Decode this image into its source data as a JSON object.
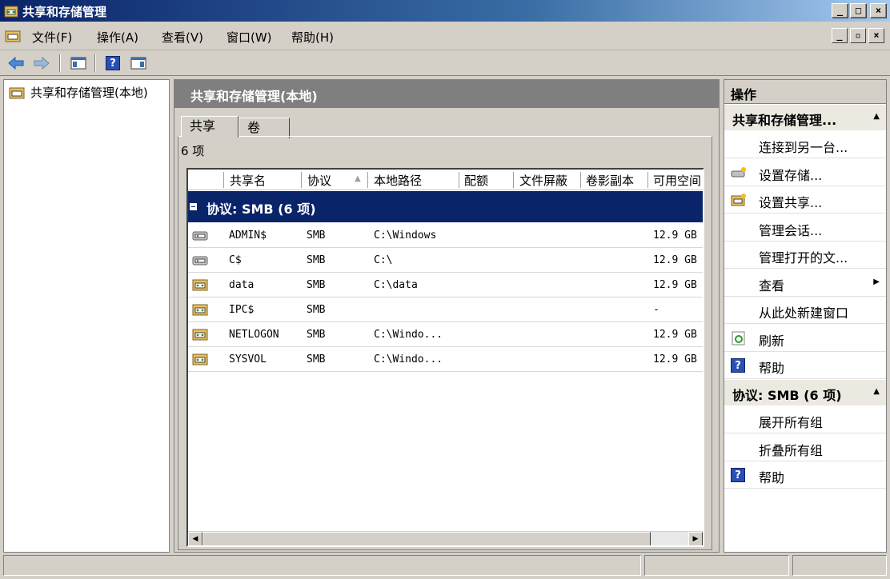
{
  "window": {
    "title": "共享和存储管理"
  },
  "menubar": {
    "items": [
      "文件(F)",
      "操作(A)",
      "查看(V)",
      "窗口(W)",
      "帮助(H)"
    ]
  },
  "tree": {
    "root_label": "共享和存储管理(本地)"
  },
  "center": {
    "header": "共享和存储管理(本地)",
    "tabs": [
      "共享",
      "卷"
    ],
    "count_text": "6 项",
    "columns": [
      "共享名",
      "协议",
      "本地路径",
      "配额",
      "文件屏蔽",
      "卷影副本",
      "可用空间"
    ],
    "group_label": "协议: SMB (6 项)",
    "rows": [
      {
        "name": "ADMIN$",
        "protocol": "SMB",
        "path": "C:\\Windows",
        "free": "12.9 GB",
        "icon": "admin-share-icon"
      },
      {
        "name": "C$",
        "protocol": "SMB",
        "path": "C:\\",
        "free": "12.9 GB",
        "icon": "admin-share-icon"
      },
      {
        "name": "data",
        "protocol": "SMB",
        "path": "C:\\data",
        "free": "12.9 GB",
        "icon": "share-folder-icon"
      },
      {
        "name": "IPC$",
        "protocol": "SMB",
        "path": "",
        "free": "-",
        "icon": "share-folder-icon"
      },
      {
        "name": "NETLOGON",
        "protocol": "SMB",
        "path": "C:\\Windo...",
        "free": "12.9 GB",
        "icon": "share-folder-icon"
      },
      {
        "name": "SYSVOL",
        "protocol": "SMB",
        "path": "C:\\Windo...",
        "free": "12.9 GB",
        "icon": "share-folder-icon"
      }
    ]
  },
  "actions": {
    "header": "操作",
    "section1": {
      "title": "共享和存储管理...",
      "items": [
        "连接到另一台...",
        "设置存储...",
        "设置共享...",
        "管理会话...",
        "管理打开的文...",
        "查看",
        "从此处新建窗口",
        "刷新",
        "帮助"
      ]
    },
    "section2": {
      "title": "协议: SMB (6 项)",
      "items": [
        "展开所有组",
        "折叠所有组",
        "帮助"
      ]
    }
  },
  "colors": {
    "title_gradient_start": "#0a246a",
    "selection": "#0a246a",
    "chrome": "#d4d0c8",
    "header_gray": "#7f7f7f"
  }
}
